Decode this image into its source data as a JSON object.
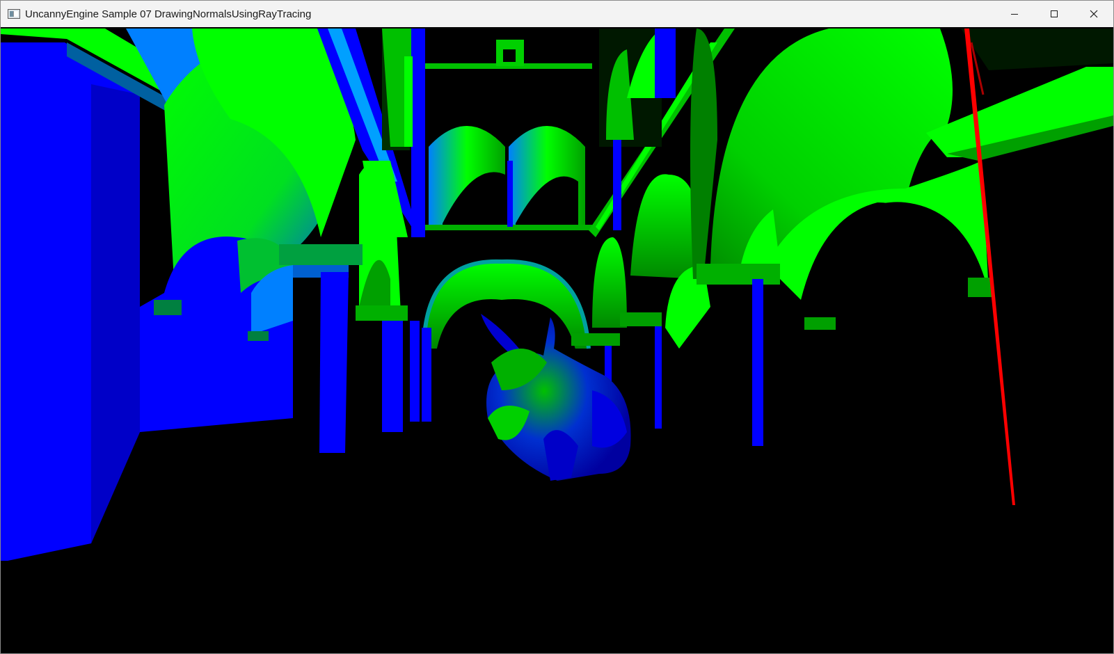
{
  "window": {
    "title": "UncannyEngine Sample 07 DrawingNormalsUsingRayTracing",
    "controls": {
      "minimize_icon": "minimize-icon",
      "maximize_icon": "maximize-icon",
      "close_icon": "close-icon"
    }
  },
  "viewport": {
    "content": "render-output",
    "colors": {
      "background": "#000000",
      "blue": "#0000ff",
      "deep_blue": "#0000c8",
      "green": "#00ff00",
      "dark_green": "#008a00",
      "red": "#ff0000"
    }
  }
}
